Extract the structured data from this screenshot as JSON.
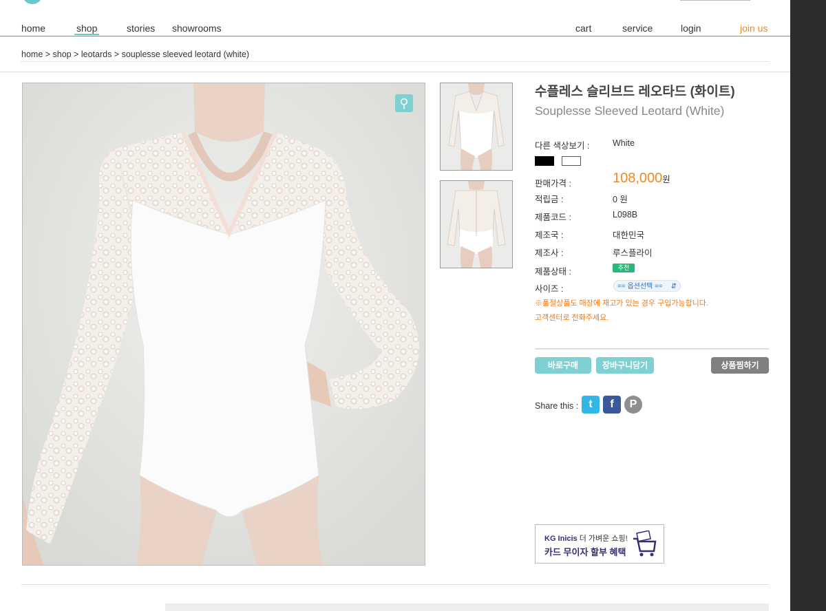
{
  "nav": {
    "home": "home",
    "shop": "shop",
    "stories": "stories",
    "showrooms": "showrooms",
    "cart": "cart",
    "service": "service",
    "login": "login",
    "join": "join us"
  },
  "breadcrumb": "home > shop > leotards > souplesse sleeved leotard (white)",
  "product": {
    "title_ko": "수플레스 슬리브드 레오타드 (화이트)",
    "title_en": "Souplesse Sleeved Leotard (White)",
    "color_label": "다른 색상보기 :",
    "color_value": "White",
    "swatches": [
      "#000000",
      "#ffffff"
    ],
    "price_label": "판매가격 :",
    "price": "108,000",
    "price_unit": "원",
    "points_label": "적립금 :",
    "points": "0 원",
    "code_label": "제품코드 :",
    "code": "L098B",
    "country_label": "제조국 :",
    "country": "대한민국",
    "maker_label": "제조사 :",
    "maker": "루스플라이",
    "status_label": "제품상태 :",
    "status_badge": "추천",
    "size_label": "사이즈 :",
    "size_select": "== 옵션선택 ==",
    "note1": "※품절상품도 매장에 재고가 있는 경우 구입가능합니다.",
    "note2": "고객센터로 전화주세요."
  },
  "buttons": {
    "buy_now": "바로구매",
    "add_cart": "장바구니담기",
    "wishlist": "상품찜하기"
  },
  "share": {
    "label": "Share this :",
    "icons": [
      "twitter-icon",
      "facebook-icon",
      "pinterest-icon"
    ]
  },
  "banner": {
    "brand": "KG Inicis",
    "tagline": "더 가벼운 쇼핑!",
    "line2": "카드 무이자 할부 혜택"
  },
  "colors": {
    "accent": "#6ec7c8",
    "orange": "#ef8a23",
    "green_badge": "#29b87a",
    "gray_button": "#808080"
  }
}
